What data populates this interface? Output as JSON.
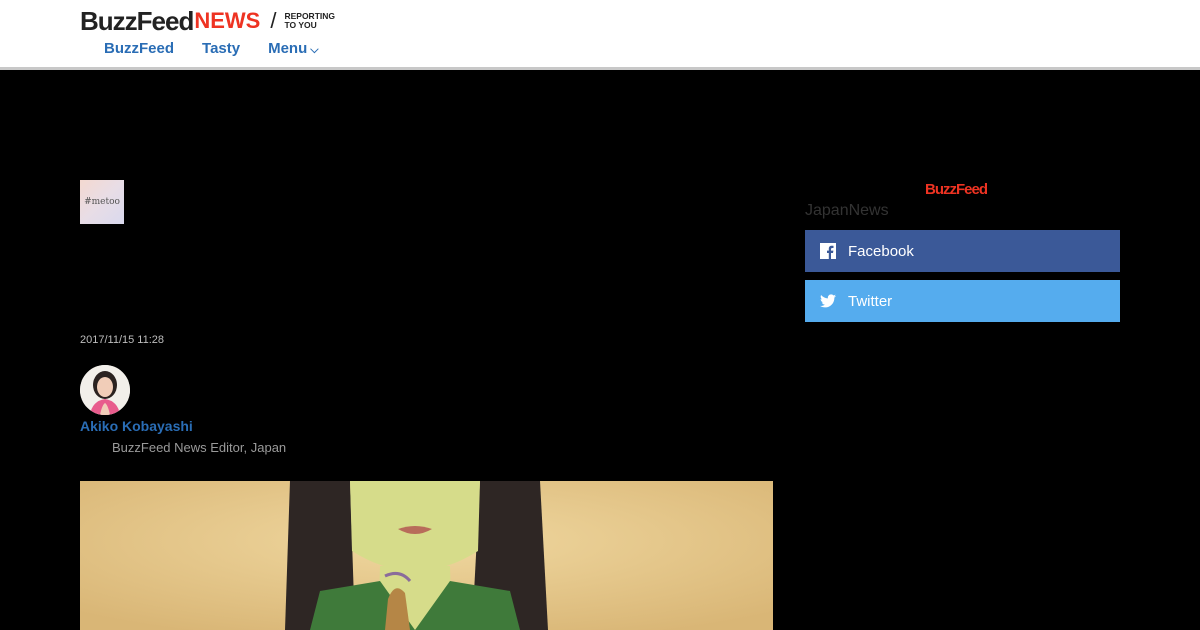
{
  "header": {
    "logo_buzz": "BuzzFeed",
    "logo_news": "NEWS",
    "logo_slash": "/",
    "logo_tagline_1": "REPORTING",
    "logo_tagline_2": "TO YOU",
    "nav": [
      "BuzzFeed",
      "Tasty",
      "Menu"
    ]
  },
  "article": {
    "tag_thumb_text": "#metoo",
    "date": "2017/11/15 11:28",
    "author_name": "Akiko Kobayashi",
    "author_role": "BuzzFeed News Editor, Japan"
  },
  "sidebar": {
    "brand": "BuzzFeed",
    "sub": "JapanNews",
    "facebook_label": "Facebook",
    "twitter_label": "Twitter"
  },
  "colors": {
    "brand_red": "#ee3322",
    "link_blue": "#2a6db5",
    "facebook": "#3b5998",
    "twitter": "#55acee"
  }
}
